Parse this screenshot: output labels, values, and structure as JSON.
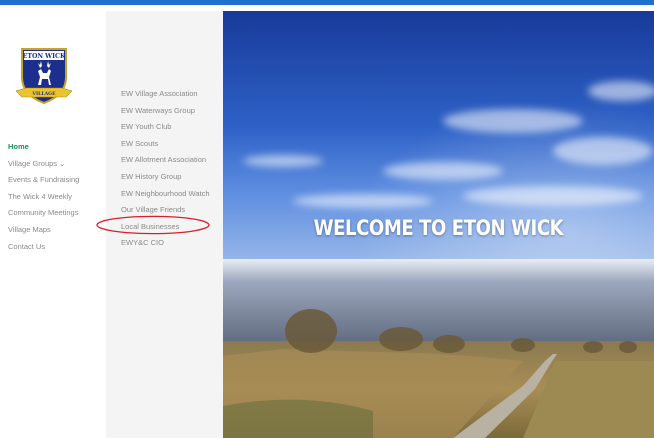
{
  "colors": {
    "accent_bar": "#1f6fd0",
    "nav_active": "#1c8f57",
    "annotation_circle": "#d9202a"
  },
  "logo": {
    "text_top": "ETON WICK",
    "text_banner": "VILLAGE"
  },
  "main_nav": {
    "items": [
      {
        "label": "Home",
        "active": true
      },
      {
        "label": "Village Groups",
        "has_submenu": true
      },
      {
        "label": "Events & Fundraising"
      },
      {
        "label": "The Wick 4 Weekly"
      },
      {
        "label": "Community Meetings"
      },
      {
        "label": "Village Maps"
      },
      {
        "label": "Contact Us"
      }
    ]
  },
  "submenu": {
    "items": [
      {
        "label": "EW Village Association"
      },
      {
        "label": "EW Waterways Group"
      },
      {
        "label": "EW Youth Club"
      },
      {
        "label": "EW Scouts"
      },
      {
        "label": "EW Allotment Association"
      },
      {
        "label": "EW History Group"
      },
      {
        "label": "EW Neighbourhood Watch"
      },
      {
        "label": "Our Village Friends"
      },
      {
        "label": "Local Businesses",
        "highlighted": true
      },
      {
        "label": "EWY&C CIO"
      }
    ]
  },
  "hero": {
    "title": "WELCOME TO ETON WICK"
  }
}
